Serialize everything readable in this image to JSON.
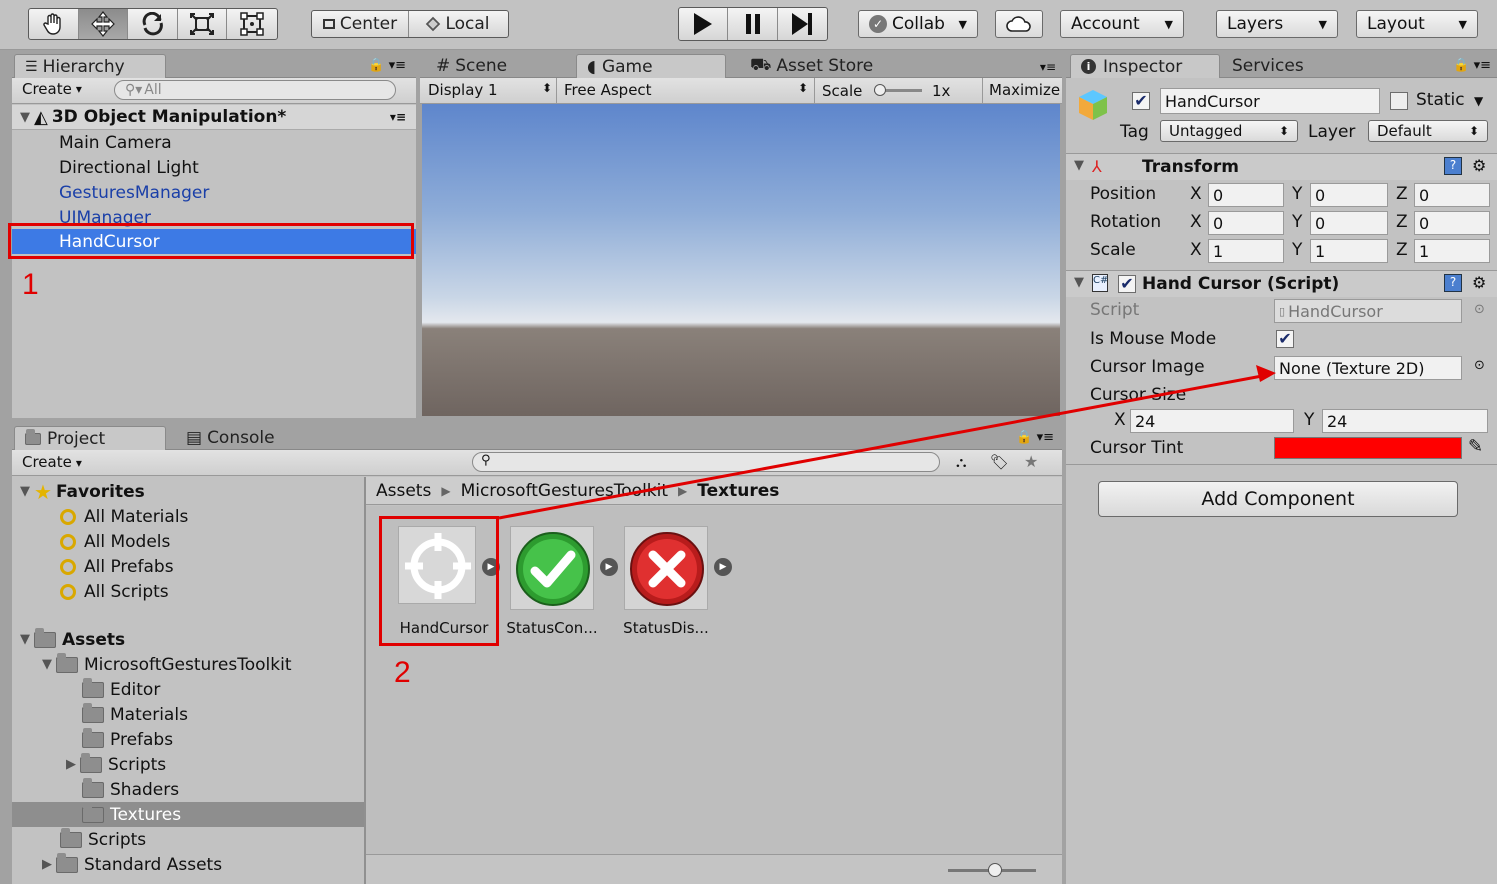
{
  "toolbar": {
    "transform_tools": [
      "hand-tool",
      "move-tool",
      "rotate-tool",
      "scale-tool",
      "rect-tool"
    ],
    "pivot_label": "Center",
    "space_label": "Local",
    "collab_label": "Collab",
    "account_label": "Account",
    "layers_label": "Layers",
    "layout_label": "Layout"
  },
  "hierarchy": {
    "tab_label": "Hierarchy",
    "create_label": "Create",
    "search_placeholder": "All",
    "scene_name": "3D Object Manipulation*",
    "items": [
      {
        "label": "Main Camera",
        "prefab": false,
        "selected": false
      },
      {
        "label": "Directional Light",
        "prefab": false,
        "selected": false
      },
      {
        "label": "GesturesManager",
        "prefab": true,
        "selected": false
      },
      {
        "label": "UIManager",
        "prefab": true,
        "selected": false
      },
      {
        "label": "HandCursor",
        "prefab": false,
        "selected": true
      }
    ]
  },
  "center_tabs": {
    "scene": "Scene",
    "game": "Game",
    "store": "Asset Store"
  },
  "game_view": {
    "display": "Display 1",
    "aspect": "Free Aspect",
    "scale_label": "Scale",
    "scale_value": "1x",
    "maximize": "Maximize"
  },
  "inspector": {
    "tab_label": "Inspector",
    "services_label": "Services",
    "object_name": "HandCursor",
    "static_label": "Static",
    "tag_label": "Tag",
    "tag_value": "Untagged",
    "layer_label": "Layer",
    "layer_value": "Default",
    "transform": {
      "title": "Transform",
      "rows": [
        {
          "label": "Position",
          "x": "0",
          "y": "0",
          "z": "0"
        },
        {
          "label": "Rotation",
          "x": "0",
          "y": "0",
          "z": "0"
        },
        {
          "label": "Scale",
          "x": "1",
          "y": "1",
          "z": "1"
        }
      ]
    },
    "script_component": {
      "title": "Hand Cursor (Script)",
      "script_label": "Script",
      "script_value": "HandCursor",
      "mouse_mode_label": "Is Mouse Mode",
      "cursor_image_label": "Cursor Image",
      "cursor_image_value": "None (Texture 2D)",
      "cursor_size_label": "Cursor Size",
      "size_x": "24",
      "size_y": "24",
      "cursor_tint_label": "Cursor Tint",
      "cursor_tint_color": "#ff0000"
    },
    "add_component": "Add Component"
  },
  "project": {
    "tab_label": "Project",
    "console_label": "Console",
    "create_label": "Create",
    "favorites": {
      "label": "Favorites",
      "items": [
        "All Materials",
        "All Models",
        "All Prefabs",
        "All Scripts"
      ]
    },
    "assets": {
      "label": "Assets",
      "toolkit": "MicrosoftGesturesToolkit",
      "toolkit_children": [
        "Editor",
        "Materials",
        "Prefabs",
        "Scripts",
        "Shaders",
        "Textures"
      ],
      "others": [
        "Scripts",
        "Standard Assets"
      ]
    },
    "breadcrumb": [
      "Assets",
      "MicrosoftGesturesToolkit",
      "Textures"
    ],
    "files": [
      "HandCursor",
      "StatusCon...",
      "StatusDis..."
    ]
  },
  "annotations": {
    "marker_1": "1",
    "marker_2": "2",
    "color": "#e00000"
  }
}
